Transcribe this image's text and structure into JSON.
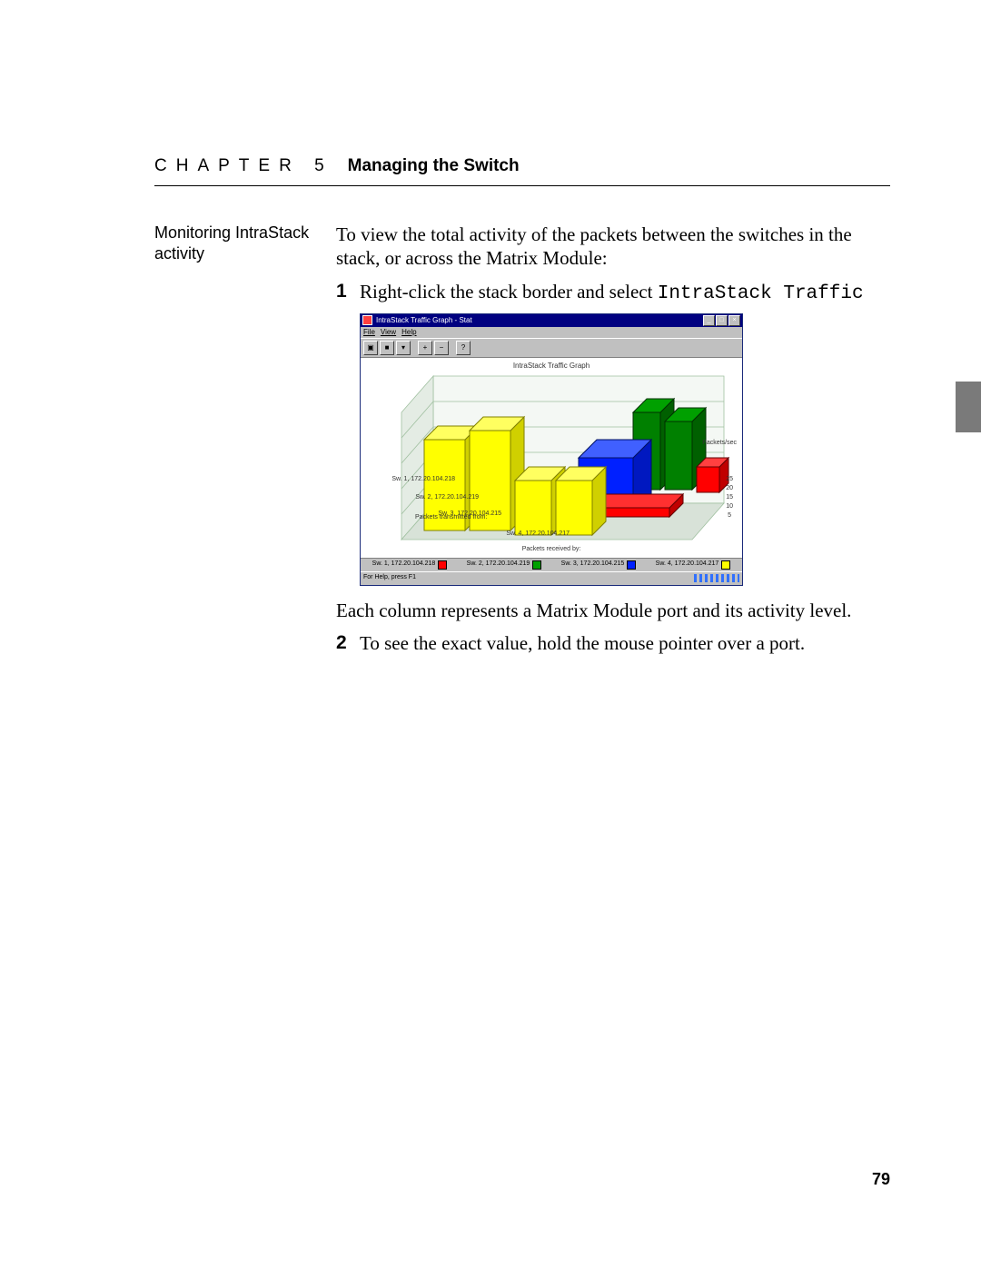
{
  "header": {
    "chapter": "CHAPTER 5",
    "title": "Managing the Switch"
  },
  "margin_heading": "Monitoring IntraStack activity",
  "intro": "To view the total activity of the packets between the switches in the stack, or across the Matrix Module:",
  "step1": {
    "num": "1",
    "text_a": "Right-click the stack border and select ",
    "text_mono": "IntraStack Traf­fic"
  },
  "after_fig": "Each column represents a Matrix Module port and its activity level.",
  "step2": {
    "num": "2",
    "text": "To see the exact value, hold the mouse pointer over a port."
  },
  "page_number": "79",
  "screenshot": {
    "title": "IntraStack Traffic Graph - Stat",
    "menus": [
      "File",
      "View",
      "Help"
    ],
    "chart_title": "IntraStack Traffic Graph",
    "y_label": "Packets/sec",
    "x_label_top": "Packets transmitted from:",
    "x_label_bottom": "Packets received by:",
    "row_labels": [
      "Sw. 1, 172.20.104.218",
      "Sw. 2, 172.20.104.219",
      "Sw. 3, 172.20.104.215",
      "Sw. 4, 172.20.104.217"
    ],
    "y_ticks": [
      "25",
      "20",
      "15",
      "10",
      "5"
    ],
    "legend": [
      {
        "label": "Sw. 1, 172.20.104.218",
        "color": "#ff0000"
      },
      {
        "label": "Sw. 2, 172.20.104.219",
        "color": "#00a000"
      },
      {
        "label": "Sw. 3, 172.20.104.215",
        "color": "#0020ff"
      },
      {
        "label": "Sw. 4, 172.20.104.217",
        "color": "#ffff00"
      }
    ],
    "status": "For Help, press F1"
  },
  "chart_data": {
    "type": "bar",
    "title": "IntraStack Traffic Graph",
    "xlabel": "Packets received by:",
    "ylabel": "Packets/sec",
    "ylim": [
      0,
      25
    ],
    "categories": [
      "Sw. 1, 172.20.104.218",
      "Sw. 2, 172.20.104.219",
      "Sw. 3, 172.20.104.215",
      "Sw. 4, 172.20.104.217"
    ],
    "series": [
      {
        "name": "Sw. 1, 172.20.104.218",
        "color": "#ff0000",
        "values": [
          0,
          3,
          3,
          10
        ]
      },
      {
        "name": "Sw. 2, 172.20.104.219",
        "color": "#00a000",
        "values": [
          0,
          0,
          16,
          16
        ]
      },
      {
        "name": "Sw. 3, 172.20.104.215",
        "color": "#0020ff",
        "values": [
          0,
          0,
          0,
          12
        ]
      },
      {
        "name": "Sw. 4, 172.20.104.217",
        "color": "#ffff00",
        "values": [
          20,
          22,
          14,
          14
        ]
      }
    ]
  }
}
